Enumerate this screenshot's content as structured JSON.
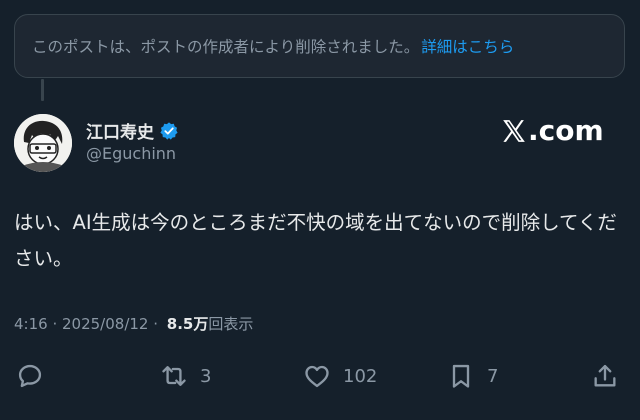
{
  "deleted_notice": {
    "text": "このポストは、ポストの作成者により削除されました。",
    "link": "詳細はこちら"
  },
  "author": {
    "display_name": "江口寿史",
    "handle": "@Eguchinn",
    "verified": true
  },
  "brand": {
    "label": ".com"
  },
  "tweet": {
    "text": "はい、AI生成は今のところまだ不快の域を出てないので削除してください。"
  },
  "meta": {
    "time": "4:16",
    "separator1": " · ",
    "date": "2025/08/12",
    "separator2": " · ",
    "views_count": "8.5",
    "views_unit": "万",
    "views_label": "回表示"
  },
  "actions": {
    "reply_count": "",
    "retweet_count": "3",
    "like_count": "102",
    "bookmark_count": "7"
  },
  "colors": {
    "background": "#15202b",
    "link": "#1d9bf0",
    "muted": "#8b98a5",
    "text": "#e7e9ea"
  }
}
